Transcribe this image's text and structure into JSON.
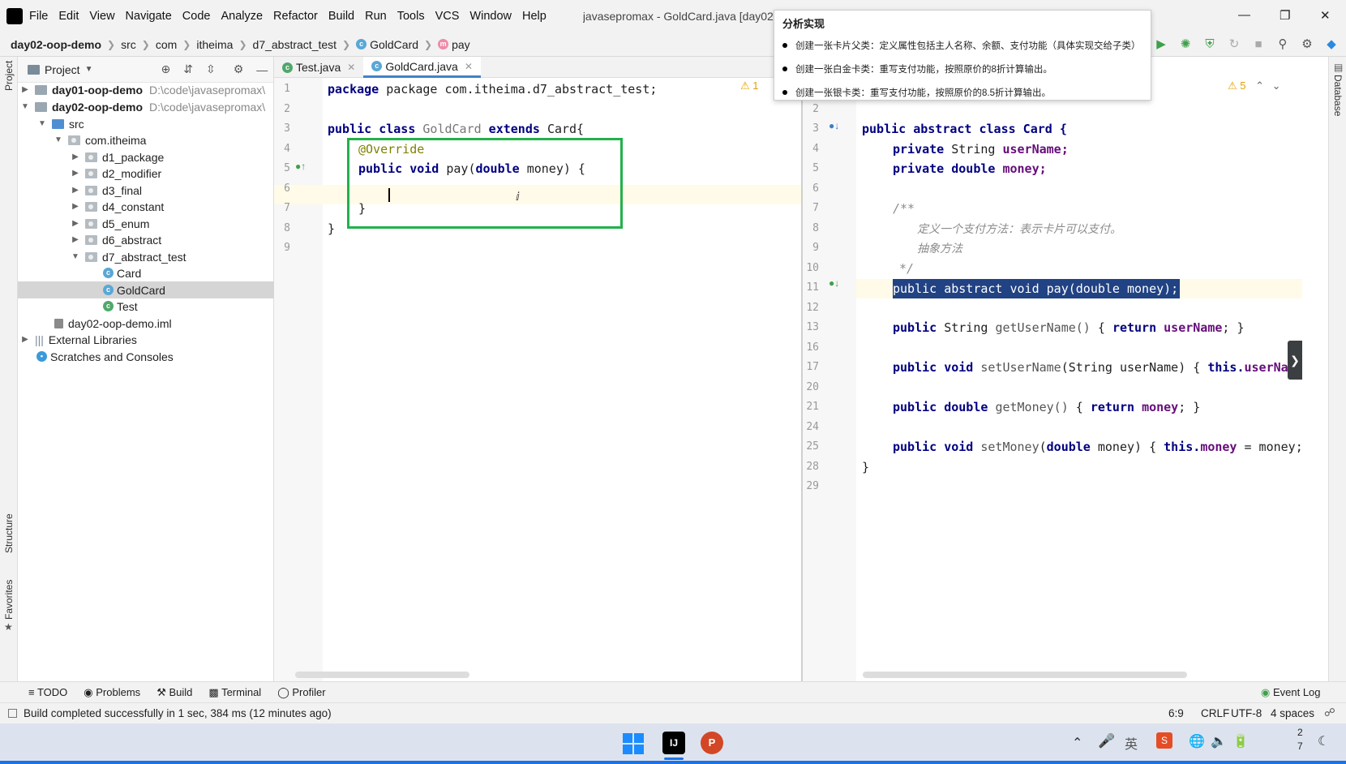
{
  "menubar": {
    "items": [
      "File",
      "Edit",
      "View",
      "Navigate",
      "Code",
      "Analyze",
      "Refactor",
      "Build",
      "Run",
      "Tools",
      "VCS",
      "Window",
      "Help"
    ],
    "title": "javasepromax - GoldCard.java [day02-oop"
  },
  "breadcrumb": {
    "project": "day02-oop-demo",
    "src": "src",
    "com": "com",
    "itheima": "itheima",
    "pkg": "d7_abstract_test",
    "cls": "GoldCard",
    "method": "pay"
  },
  "project_panel": {
    "title": "Project",
    "tree": [
      {
        "label": "day01-oop-demo",
        "path": "D:\\code\\javasepromax\\"
      },
      {
        "label": "day02-oop-demo",
        "path": "D:\\code\\javasepromax\\"
      },
      {
        "label": "src"
      },
      {
        "label": "com.itheima"
      },
      {
        "label": "d1_package"
      },
      {
        "label": "d2_modifier"
      },
      {
        "label": "d3_final"
      },
      {
        "label": "d4_constant"
      },
      {
        "label": "d5_enum"
      },
      {
        "label": "d6_abstract"
      },
      {
        "label": "d7_abstract_test"
      },
      {
        "label": "Card"
      },
      {
        "label": "GoldCard"
      },
      {
        "label": "Test"
      },
      {
        "label": "day02-oop-demo.iml"
      },
      {
        "label": "External Libraries"
      },
      {
        "label": "Scratches and Consoles"
      }
    ]
  },
  "tabs": [
    {
      "label": "Test.java"
    },
    {
      "label": "GoldCard.java"
    }
  ],
  "left_editor": {
    "warn_count": "1",
    "lines": [
      "1",
      "2",
      "3",
      "4",
      "5",
      "6",
      "7",
      "8",
      "9"
    ],
    "l1": "package com.itheima.d7_abstract_test;",
    "l3a": "public class ",
    "l3b": "GoldCard",
    "l3c": " extends ",
    "l3d": "Card{",
    "l4": "@Override",
    "l5a": "public void ",
    "l5b": "pay(",
    "l5c": "double",
    "l5d": " money) {",
    "l7": "}",
    "l8": "}"
  },
  "right_editor": {
    "warn_count": "5",
    "lines": [
      "2",
      "3",
      "4",
      "5",
      "6",
      "7",
      "8",
      "9",
      "10",
      "11",
      "12",
      "13",
      "16",
      "17",
      "20",
      "21",
      "24",
      "25",
      "28",
      "29"
    ],
    "l3": "public abstract class Card {",
    "l4a": "private ",
    "l4b": "String ",
    "l4c": "userName;",
    "l5a": "private double ",
    "l5b": "money;",
    "l7": "/**",
    "l8": "定义一个支付方法：表示卡片可以支付。",
    "l9": "抽象方法",
    "l10": "*/",
    "l11": "public abstract void pay(double money);",
    "l13a": "public ",
    "l13b": "String ",
    "l13c": "getUserName()",
    "l13d": " { ",
    "l13e": "return ",
    "l13f": "userName",
    "l13g": "; }",
    "l17a": "public void ",
    "l17b": "setUserName",
    "l17c": "(String userName) { ",
    "l17d": "this.",
    "l17e": "userName",
    "l21a": "public double ",
    "l21b": "getMoney()",
    "l21c": " { ",
    "l21d": "return ",
    "l21e": "money",
    "l21f": "; }",
    "l25a": "public void ",
    "l25b": "setMoney",
    "l25c": "(",
    "l25d": "double",
    "l25e": " money) { ",
    "l25f": "this.",
    "l25g": "money",
    "l25h": " = money;",
    "l28": "}"
  },
  "popup": {
    "title": "分析实现",
    "items": [
      "创建一张卡片父类：定义属性包括主人名称、余额、支付功能（具体实现交给子类）",
      "创建一张白金卡类：重写支付功能，按照原价的8折计算输出。",
      "创建一张银卡类：重写支付功能，按照原价的8.5折计算输出。"
    ]
  },
  "side_tabs": {
    "project": "Project",
    "structure": "Structure",
    "favorites": "Favorites",
    "database": "Database"
  },
  "bottom_tools": [
    "TODO",
    "Problems",
    "Build",
    "Terminal",
    "Profiler"
  ],
  "event_log": "Event Log",
  "status": {
    "message": "Build completed successfully in 1 sec, 384 ms (12 minutes ago)",
    "position": "6:9",
    "line_sep": "CRLF",
    "encoding": "UTF-8",
    "indent": "4 spaces"
  },
  "taskbar": {
    "clock_a": "2",
    "clock_b": "7"
  }
}
